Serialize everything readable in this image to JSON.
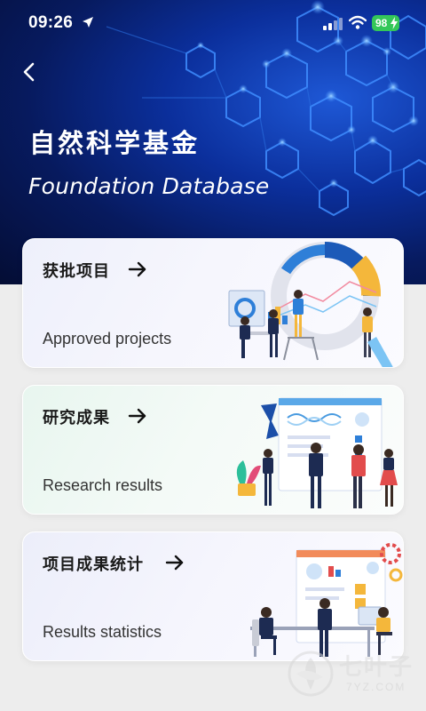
{
  "status_bar": {
    "time": "09:26",
    "battery": "98",
    "icons": [
      "location-arrow-icon",
      "signal-icon",
      "wifi-icon",
      "battery-charging-icon"
    ]
  },
  "header": {
    "back_icon": "chevron-left-icon",
    "title_cn": "自然科学基金",
    "title_en": "Foundation Database"
  },
  "cards": [
    {
      "title": "获批项目",
      "subtitle": "Approved projects",
      "arrow_icon": "arrow-right-icon",
      "illustration": "team-dashboard-illustration"
    },
    {
      "title": "研究成果",
      "subtitle": "Research results",
      "arrow_icon": "arrow-right-icon",
      "illustration": "presentation-board-illustration"
    },
    {
      "title": "项目成果统计",
      "subtitle": "Results statistics",
      "arrow_icon": "arrow-right-icon",
      "illustration": "office-analytics-illustration"
    }
  ],
  "watermark": {
    "text_cn": "七叶子",
    "text_en": "7YZ.COM"
  },
  "colors": {
    "hero_dark": "#040d34",
    "hero_mid": "#0b2f9c",
    "hero_glow": "#1e58d6",
    "battery_green": "#34c759",
    "page_bg": "#ededed"
  }
}
